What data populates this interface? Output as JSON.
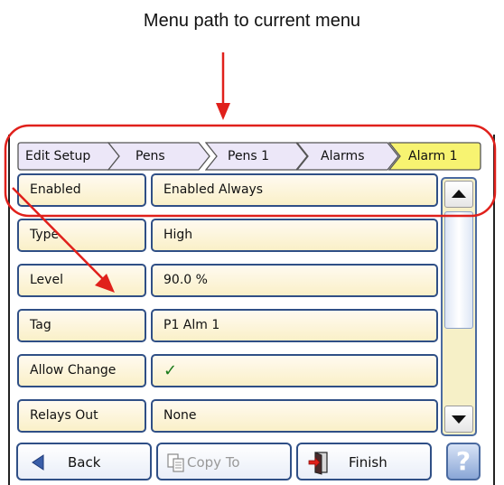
{
  "annotation": {
    "title": "Menu path to current menu",
    "highlight_color": "#e0201b"
  },
  "breadcrumb": [
    {
      "label": "Edit Setup",
      "active": false
    },
    {
      "label": "Pens",
      "active": false
    },
    {
      "label": "Pens 1",
      "active": false
    },
    {
      "label": "Alarms",
      "active": false
    },
    {
      "label": "Alarm 1",
      "active": true
    }
  ],
  "settings": [
    {
      "label": "Enabled",
      "value": "Enabled Always"
    },
    {
      "label": "Type",
      "value": "High"
    },
    {
      "label": "Level",
      "value": "90.0 %"
    },
    {
      "label": "Tag",
      "value": "P1 Alm 1"
    },
    {
      "label": "Allow Change",
      "value": "✓"
    },
    {
      "label": "Relays Out",
      "value": "None"
    }
  ],
  "footer": {
    "back_label": "Back",
    "copy_label": "Copy To",
    "finish_label": "Finish",
    "help_label": "?"
  },
  "colors": {
    "crumb_fill": "#ece7f8",
    "crumb_active_fill": "#f7f371",
    "cell_border": "#2f4f86",
    "cell_fill": "#faf0c8"
  }
}
